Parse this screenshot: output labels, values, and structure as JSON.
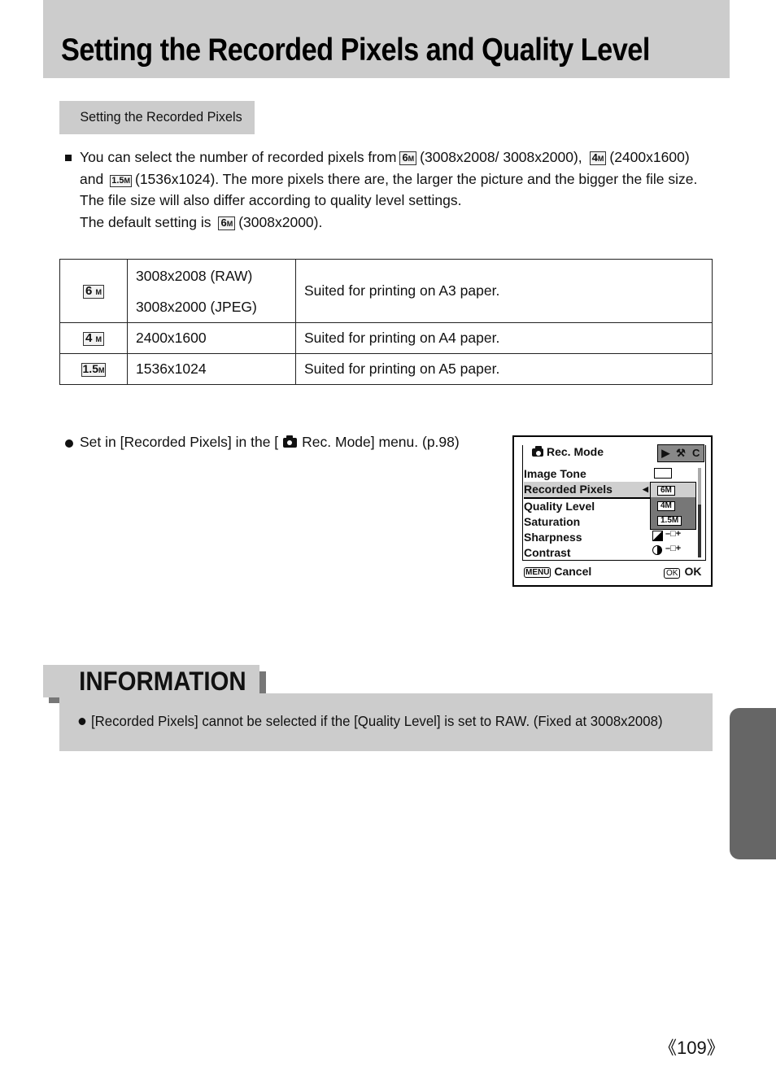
{
  "page_title": "Setting the Recorded Pixels and Quality Level",
  "section_tab": "Setting the Recorded Pixels",
  "intro": {
    "l1a": "You can select the number of recorded pixels from",
    "l1b": "(3008x2008/ 3008x2000),",
    "l1c": "(2400x1600)",
    "l2a": "and",
    "l2b": "(1536x1024). The more pixels there are, the larger the picture and the bigger the file size.",
    "l3": "The file size will also differ according to quality level settings.",
    "l4a": "The default setting is",
    "l4b": "(3008x2000)."
  },
  "icons": {
    "m6": "6",
    "m4": "4",
    "m15": "1.5",
    "unit": "M"
  },
  "table": {
    "rows": [
      {
        "icon": "6M",
        "res": [
          "3008x2008 (RAW)",
          "3008x2000 (JPEG)"
        ],
        "desc": "Suited for printing on A3 paper."
      },
      {
        "icon": "4M",
        "res": [
          "2400x1600"
        ],
        "desc": "Suited for printing on A4 paper."
      },
      {
        "icon": "1.5M",
        "res": [
          "1536x1024"
        ],
        "desc": "Suited for printing on A5 paper."
      }
    ]
  },
  "set_in": {
    "a": "Set in [Recorded Pixels] in the [",
    "b": "Rec. Mode] menu. (p.98)"
  },
  "lcd": {
    "header": "Rec. Mode",
    "tabs": [
      "▶",
      "⚒",
      "C"
    ],
    "items": [
      "Image Tone",
      "Recorded Pixels",
      "Quality Level",
      "Saturation",
      "Sharpness",
      "Contrast"
    ],
    "selected_item": "Recorded Pixels",
    "options": [
      "6M",
      "4M",
      "1.5M"
    ],
    "selected_option": "6M",
    "cancel_key": "MENU",
    "cancel_label": "Cancel",
    "ok_key": "OK",
    "ok_label": "OK"
  },
  "information": {
    "title": "INFORMATION",
    "text": "[Recorded Pixels] cannot be selected if the [Quality Level] is set to RAW. (Fixed at 3008x2008)"
  },
  "page_number": "《109》"
}
